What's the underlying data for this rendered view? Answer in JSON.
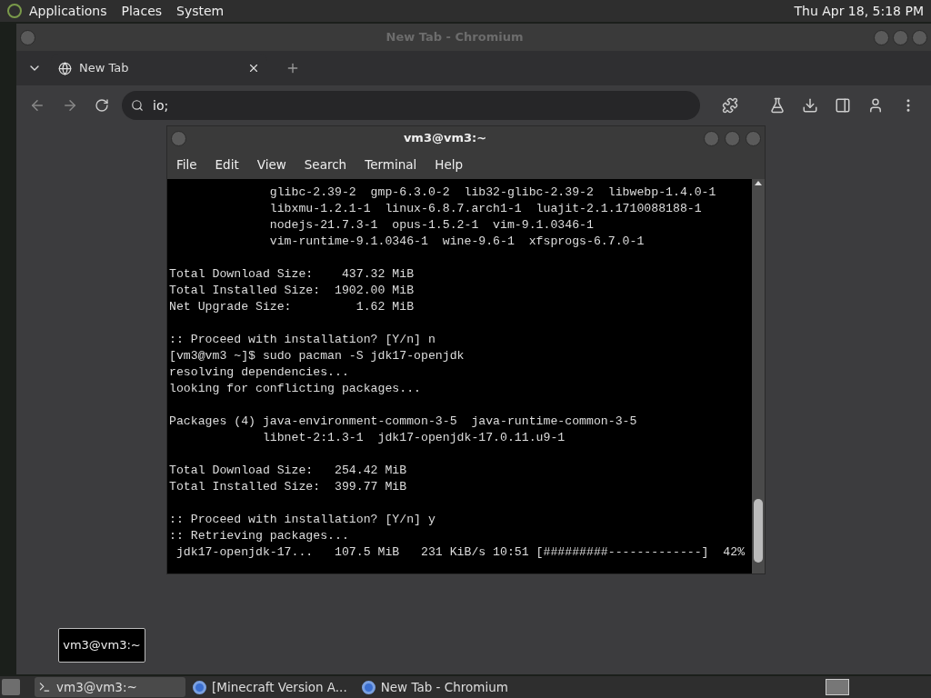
{
  "top_panel": {
    "menus": [
      "Applications",
      "Places",
      "System"
    ],
    "clock": "Thu Apr 18,  5:18 PM"
  },
  "browser": {
    "title": "New Tab - Chromium",
    "tabs": [
      {
        "label": "New Tab",
        "selected": true
      }
    ],
    "address": "io;"
  },
  "terminal": {
    "title": "vm3@vm3:~",
    "menus": [
      "File",
      "Edit",
      "View",
      "Search",
      "Terminal",
      "Help"
    ],
    "lines": [
      {
        "kind": "text",
        "text": "              glibc-2.39-2  gmp-6.3.0-2  lib32-glibc-2.39-2  libwebp-1.4.0-1"
      },
      {
        "kind": "text",
        "text": "              libxmu-1.2.1-1  linux-6.8.7.arch1-1  luajit-2.1.1710088188-1"
      },
      {
        "kind": "text",
        "text": "              nodejs-21.7.3-1  opus-1.5.2-1  vim-9.1.0346-1"
      },
      {
        "kind": "text",
        "text": "              vim-runtime-9.1.0346-1  wine-9.6-1  xfsprogs-6.7.0-1"
      },
      {
        "kind": "blank"
      },
      {
        "kind": "text",
        "text": "Total Download Size:    437.32 MiB"
      },
      {
        "kind": "text",
        "text": "Total Installed Size:  1902.00 MiB"
      },
      {
        "kind": "text",
        "text": "Net Upgrade Size:         1.62 MiB"
      },
      {
        "kind": "blank"
      },
      {
        "kind": "text",
        "text": ":: Proceed with installation? [Y/n] n"
      },
      {
        "kind": "text",
        "text": "[vm3@vm3 ~]$ sudo pacman -S jdk17-openjdk"
      },
      {
        "kind": "text",
        "text": "resolving dependencies..."
      },
      {
        "kind": "text",
        "text": "looking for conflicting packages..."
      },
      {
        "kind": "blank"
      },
      {
        "kind": "text",
        "text": "Packages (4) java-environment-common-3-5  java-runtime-common-3-5"
      },
      {
        "kind": "text",
        "text": "             libnet-2:1.3-1  jdk17-openjdk-17.0.11.u9-1"
      },
      {
        "kind": "blank"
      },
      {
        "kind": "text",
        "text": "Total Download Size:   254.42 MiB"
      },
      {
        "kind": "text",
        "text": "Total Installed Size:  399.77 MiB"
      },
      {
        "kind": "blank"
      },
      {
        "kind": "text",
        "text": ":: Proceed with installation? [Y/n] y"
      },
      {
        "kind": "text",
        "text": ":: Retrieving packages..."
      },
      {
        "kind": "text",
        "text": " jdk17-openjdk-17...   107.5 MiB   231 KiB/s 10:51 [#########-------------]  42%"
      }
    ]
  },
  "tooltip": "vm3@vm3:~",
  "taskbar": {
    "items": [
      {
        "kind": "terminal",
        "label": "vm3@vm3:~",
        "selected": true
      },
      {
        "kind": "browser",
        "label": "[Minecraft Version A...",
        "selected": false
      },
      {
        "kind": "browser",
        "label": "New Tab - Chromium",
        "selected": false
      }
    ]
  }
}
